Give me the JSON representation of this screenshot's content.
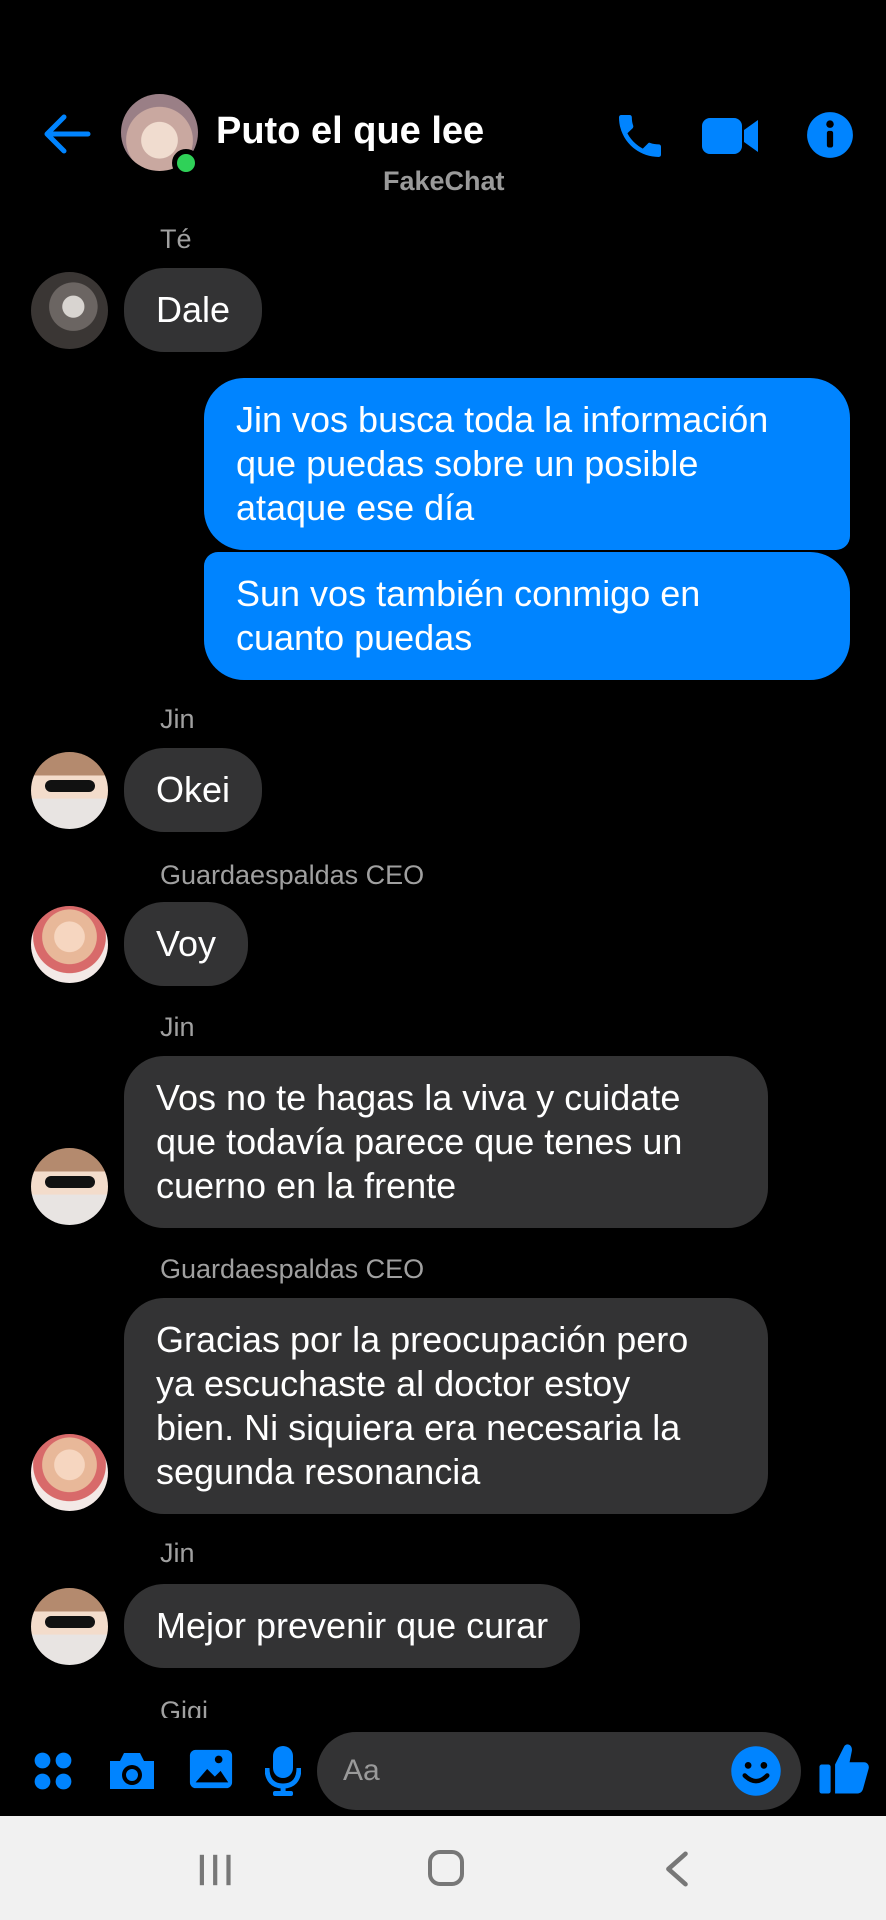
{
  "header": {
    "title": "Puto el que lee",
    "subtitle": "FakeChat",
    "icons": [
      "back-arrow-icon",
      "phone-icon",
      "video-camera-icon",
      "info-icon"
    ],
    "accent_color": "#0084ff"
  },
  "messages": [
    {
      "sender": "Té",
      "text": "Dale",
      "direction": "in"
    },
    {
      "text": "Jin vos busca toda la información\nque puedas sobre un posible\nataque ese día",
      "direction": "out"
    },
    {
      "text": "Sun vos también conmigo en\ncuanto puedas",
      "direction": "out"
    },
    {
      "sender": "Jin",
      "text": "Okei",
      "direction": "in"
    },
    {
      "sender": "Guardaespaldas CEO",
      "text": "Voy",
      "direction": "in"
    },
    {
      "sender": "Jin",
      "text": "Vos no te hagas la viva y cuidate\nque todavía parece que tenes un\ncuerno en la frente",
      "direction": "in"
    },
    {
      "sender": "Guardaespaldas CEO",
      "text": "Gracias por la preocupación pero\nya escuchaste al doctor estoy\nbien. Ni siquiera era necesaria la\nsegunda resonancia",
      "direction": "in"
    },
    {
      "sender": "Jin",
      "text": "Mejor prevenir que curar",
      "direction": "in"
    },
    {
      "sender": "Gigi"
    }
  ],
  "composer": {
    "placeholder": "Aa",
    "icons": [
      "apps-grid-icon",
      "camera-icon",
      "image-icon",
      "microphone-icon",
      "emoji-icon",
      "thumbs-up-icon"
    ]
  },
  "navbar": {
    "icons": [
      "recent-apps-icon",
      "home-icon",
      "back-icon"
    ]
  }
}
